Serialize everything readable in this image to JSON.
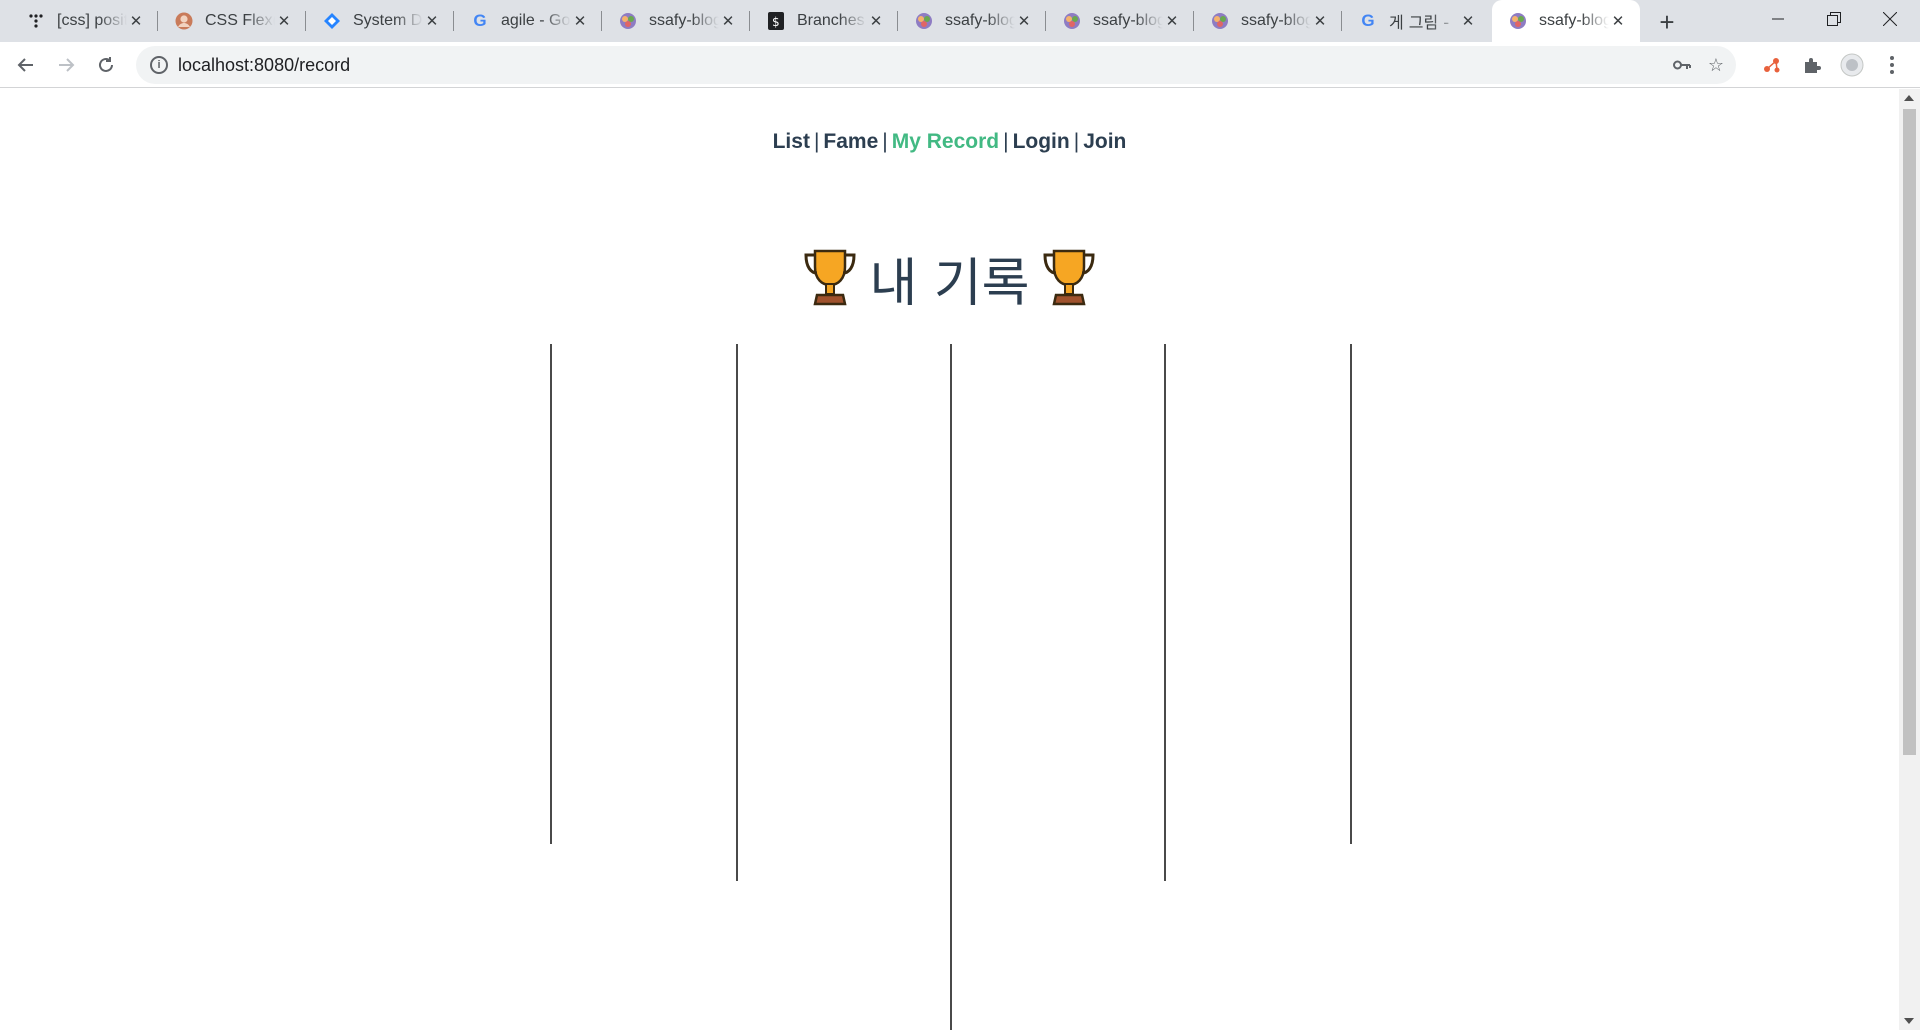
{
  "browser": {
    "tabs": [
      {
        "title": "[css] posit",
        "icon": "dots-icon"
      },
      {
        "title": "CSS Flex(F",
        "icon": "avatar-icon"
      },
      {
        "title": "System De",
        "icon": "diamond-icon"
      },
      {
        "title": "agile - Go",
        "icon": "google-icon"
      },
      {
        "title": "ssafy-blog",
        "icon": "vue-icon"
      },
      {
        "title": "Branches",
        "icon": "bitbucket-icon"
      },
      {
        "title": "ssafy-blog",
        "icon": "vue-icon"
      },
      {
        "title": "ssafy-blog",
        "icon": "vue-icon"
      },
      {
        "title": "ssafy-blog",
        "icon": "vue-icon"
      },
      {
        "title": "게 그림 -",
        "icon": "google-icon"
      },
      {
        "title": "ssafy-blog",
        "icon": "vue-icon",
        "active": true
      }
    ],
    "url": "localhost:8080/record"
  },
  "page": {
    "nav": {
      "list": "List",
      "fame": "Fame",
      "my_record": "My Record",
      "login": "Login",
      "join": "Join",
      "separator": "|"
    },
    "heading": "내 기록",
    "active_nav": "My Record",
    "accent_color": "#42b983",
    "text_color": "#2c3e50"
  }
}
